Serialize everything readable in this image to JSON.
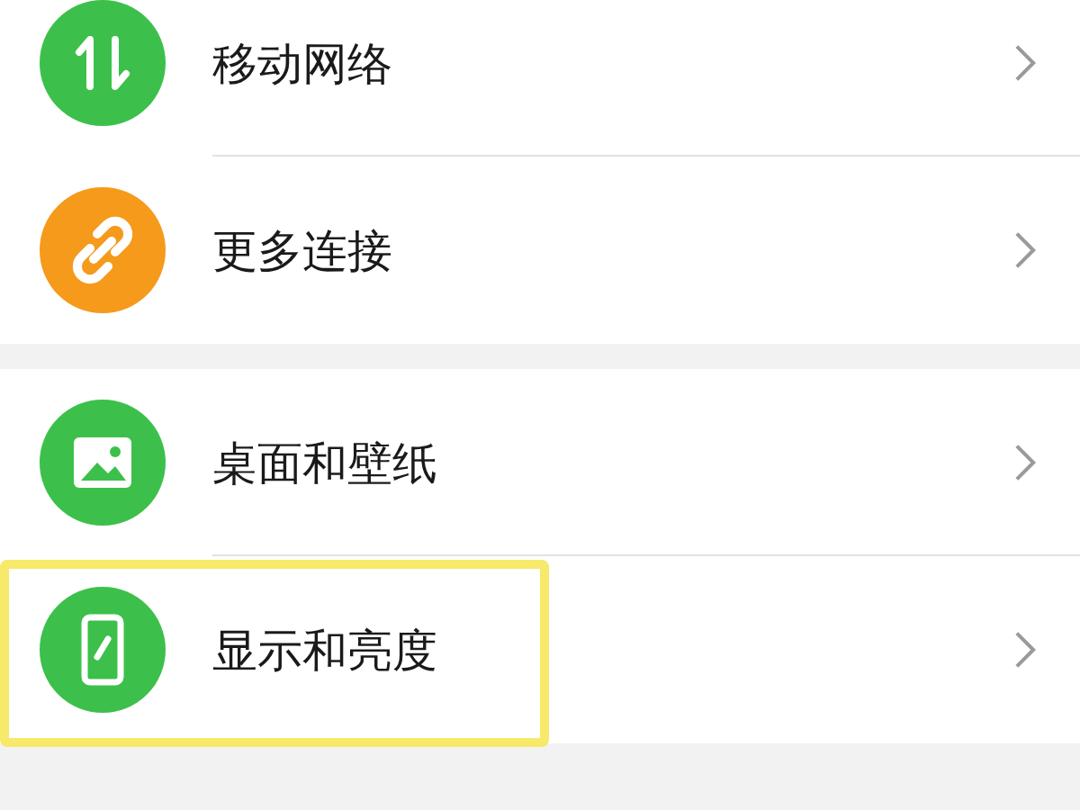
{
  "groups": [
    {
      "items": [
        {
          "label": "移动网络",
          "kind": "arrows",
          "color": "#3cc04b",
          "highlighted": false
        },
        {
          "label": "更多连接",
          "kind": "link",
          "color": "#f59a1b",
          "highlighted": false
        }
      ]
    },
    {
      "items": [
        {
          "label": "桌面和壁纸",
          "kind": "image",
          "color": "#3cc04b",
          "highlighted": false
        },
        {
          "label": "显示和亮度",
          "kind": "phone",
          "color": "#3cc04b",
          "highlighted": true
        }
      ]
    }
  ]
}
